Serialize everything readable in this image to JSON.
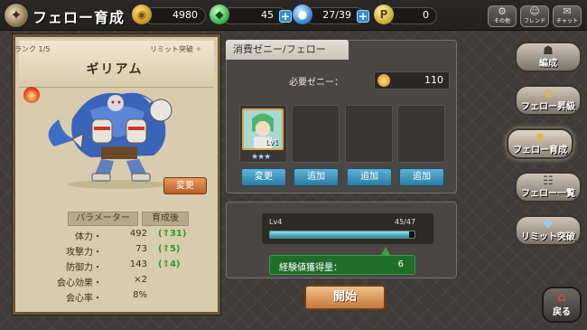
{
  "header": {
    "title": "フェロー育成",
    "resources": [
      {
        "icon": "gold-coins-icon",
        "value": "4980"
      },
      {
        "icon": "green-crystal-icon",
        "value": "45"
      },
      {
        "icon": "blue-orb-icon",
        "value": "27/39"
      },
      {
        "icon": "p-ticket-icon",
        "label": "P",
        "value": "0"
      }
    ],
    "buttons": [
      {
        "icon": "gear-icon",
        "label": "その他"
      },
      {
        "icon": "friends-icon",
        "label": "フレンド"
      },
      {
        "icon": "chat-icon",
        "label": "チャット"
      }
    ]
  },
  "character": {
    "rank": "ランク 1/5",
    "limit": "リミット突破 ✧",
    "name": "ギリアム",
    "change_button": "変更",
    "stats_header": {
      "param": "パラメーター",
      "after": "育成後"
    },
    "stats": [
      {
        "label": "体力・",
        "value": "492",
        "up": "(⇑31)"
      },
      {
        "label": "攻撃力・",
        "value": "73",
        "up": "(⇑5)"
      },
      {
        "label": "防御力・",
        "value": "143",
        "up": "(⇑4)"
      },
      {
        "label": "会心効果・",
        "value": "×2",
        "up": ""
      },
      {
        "label": "会心率・",
        "value": "8%",
        "up": ""
      }
    ]
  },
  "fodder": {
    "tab_title": "消費ゼニー/フェロー",
    "zeny_label": "必要ゼニー：",
    "zeny_value": "110",
    "card_level": "Lv1",
    "card_stars": "★★★",
    "slot_buttons": [
      "変更",
      "追加",
      "追加",
      "追加"
    ]
  },
  "exp": {
    "level": "Lv4",
    "count": "45/47",
    "progress": 0.96,
    "gain_label": "経験値獲得量：",
    "gain_value": "6"
  },
  "start_button": "開始",
  "nav": [
    {
      "icon": "formation-icon",
      "label": "編成"
    },
    {
      "icon": "fellow-upgrade-icon",
      "label": "フェロー昇級"
    },
    {
      "icon": "fellow-train-icon",
      "label": "フェロー育成",
      "active": true
    },
    {
      "icon": "fellow-list-icon",
      "label": "フェロー一覧"
    },
    {
      "icon": "limit-break-icon",
      "label": "リミット突破"
    }
  ],
  "back_button": "戻る"
}
